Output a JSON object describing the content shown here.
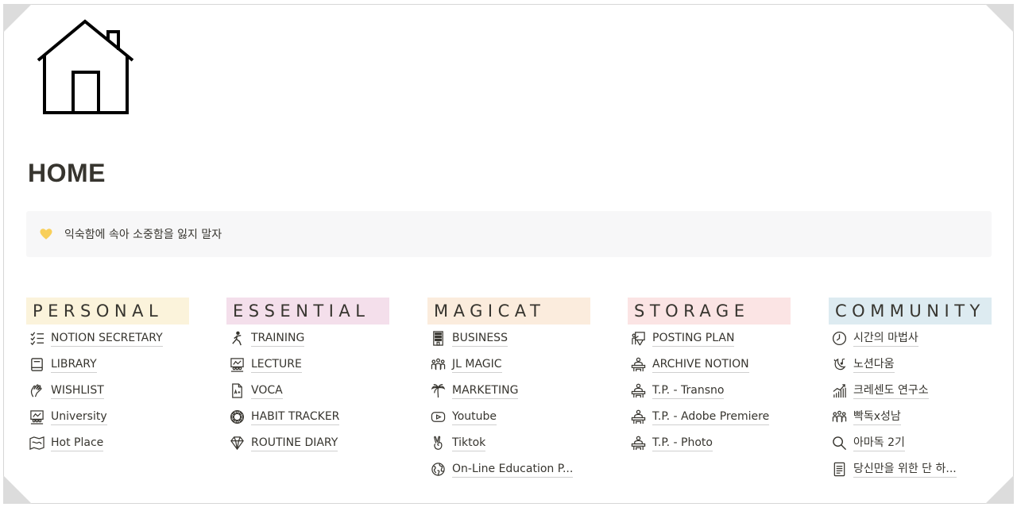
{
  "page": {
    "title": "HOME",
    "icon": "house-icon"
  },
  "callout": {
    "icon": "yellow-heart-icon",
    "text": "익숙함에 속아 소중함을 잃지 말자"
  },
  "columns": [
    {
      "id": "personal",
      "header": "PERSONAL",
      "color": "#fbf3db",
      "items": [
        {
          "label": "NOTION SECRETARY",
          "icon": "checklist-icon"
        },
        {
          "label": "LIBRARY",
          "icon": "book-icon"
        },
        {
          "label": "WISHLIST",
          "icon": "hand-icon"
        },
        {
          "label": "University",
          "icon": "classroom-icon"
        },
        {
          "label": "Hot Place",
          "icon": "map-icon"
        }
      ]
    },
    {
      "id": "essential",
      "header": "ESSENTIAL",
      "color": "#f4dfeb",
      "items": [
        {
          "label": "TRAINING",
          "icon": "runner-icon"
        },
        {
          "label": "LECTURE",
          "icon": "classroom-icon"
        },
        {
          "label": "VOCA",
          "icon": "document-grade-icon"
        },
        {
          "label": "HABIT TRACKER",
          "icon": "gear-ring-icon"
        },
        {
          "label": "ROUTINE DIARY",
          "icon": "diamond-icon"
        }
      ]
    },
    {
      "id": "magicat",
      "header": "MAGICAT",
      "color": "#fbecdd",
      "items": [
        {
          "label": "BUSINESS",
          "icon": "building-icon"
        },
        {
          "label": "JL MAGIC",
          "icon": "people-icon"
        },
        {
          "label": "MARKETING",
          "icon": "palm-tree-icon"
        },
        {
          "label": "Youtube",
          "icon": "play-button-icon"
        },
        {
          "label": "Tiktok",
          "icon": "peace-hand-icon"
        },
        {
          "label": "On-Line Education P...",
          "icon": "globe-icon"
        }
      ]
    },
    {
      "id": "storage",
      "header": "STORAGE",
      "color": "#fbe4e4",
      "items": [
        {
          "label": "POSTING PLAN",
          "icon": "presentation-icon"
        },
        {
          "label": "ARCHIVE NOTION",
          "icon": "person-desk-icon"
        },
        {
          "label": "T.P. - Transno",
          "icon": "person-desk-icon"
        },
        {
          "label": "T.P. - Adobe Premiere",
          "icon": "person-desk-icon"
        },
        {
          "label": "T.P. - Photo",
          "icon": "person-desk-icon"
        }
      ]
    },
    {
      "id": "community",
      "header": "COMMUNITY",
      "color": "#ddebf1",
      "items": [
        {
          "label": "시간의 마법사",
          "icon": "clock-icon"
        },
        {
          "label": "노션다움",
          "icon": "moon-music-icon"
        },
        {
          "label": "크레센도 연구소",
          "icon": "bar-chart-icon"
        },
        {
          "label": "빡독x성남",
          "icon": "people-icon"
        },
        {
          "label": "아마독 2기",
          "icon": "search-icon"
        },
        {
          "label": "당신만을 위한 단 하...",
          "icon": "document-icon"
        }
      ]
    }
  ]
}
